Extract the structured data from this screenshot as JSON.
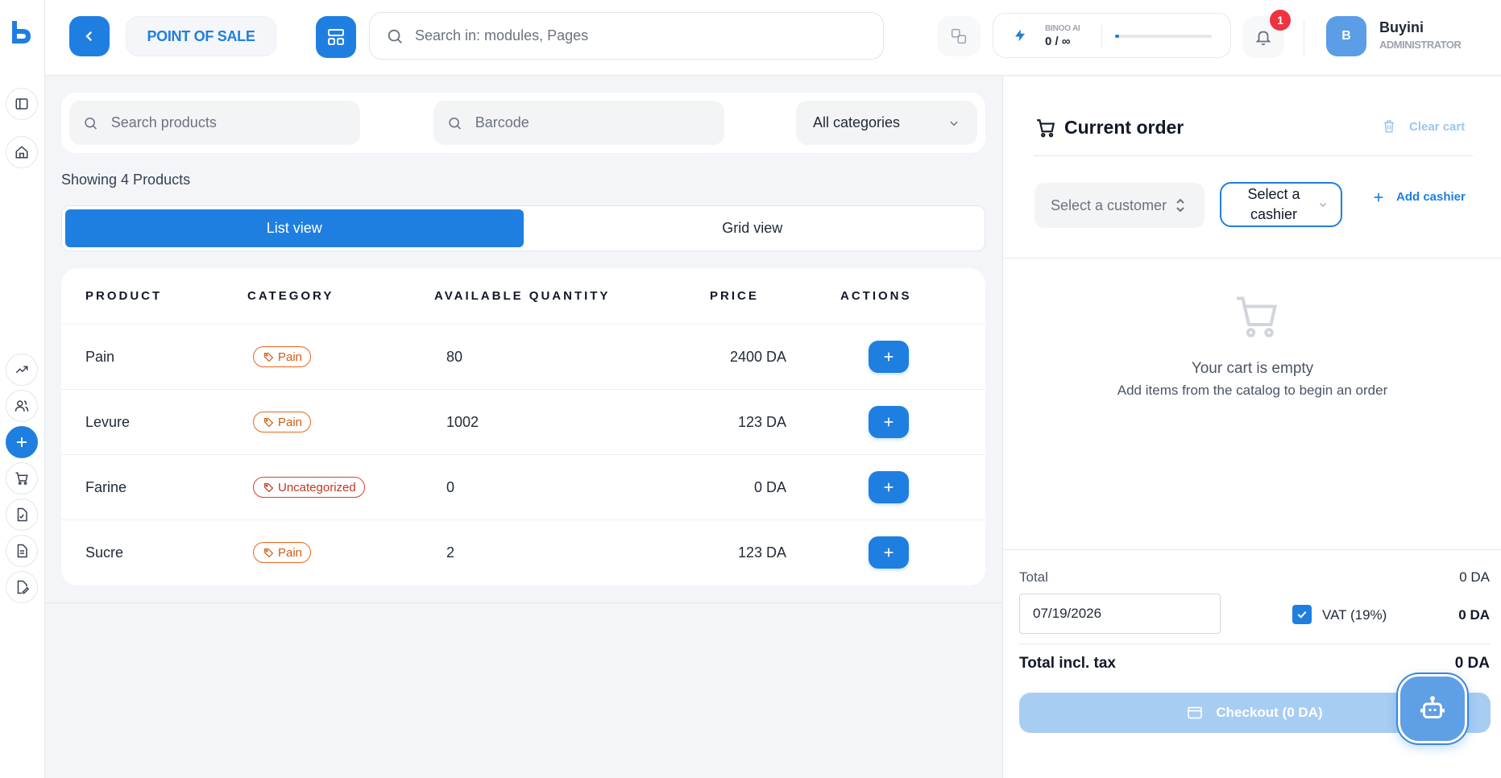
{
  "header": {
    "app_title": "POINT OF SALE",
    "search_placeholder": "Search in: modules, Pages",
    "ai": {
      "name": "BINOO AI",
      "usage": "0 / ∞",
      "progress_fraction": 0.02
    },
    "notifications_count": "1",
    "user": {
      "initial": "B",
      "name": "Buyini",
      "role": "ADMINISTRATOR"
    }
  },
  "filters": {
    "search_placeholder": "Search products",
    "barcode_placeholder": "Barcode",
    "category_selected": "All categories"
  },
  "showing_text": "Showing 4 Products",
  "view_toggle": {
    "list": "List view",
    "grid": "Grid view",
    "active": "list"
  },
  "table": {
    "headers": [
      "PRODUCT",
      "CATEGORY",
      "AVAILABLE QUANTITY",
      "PRICE",
      "ACTIONS"
    ],
    "rows": [
      {
        "product": "Pain",
        "category": "Pain",
        "quantity": "80",
        "price": "2400 DA"
      },
      {
        "product": "Levure",
        "category": "Pain",
        "quantity": "1002",
        "price": "123 DA"
      },
      {
        "product": "Farine",
        "category": "Uncategorized",
        "quantity": "0",
        "price": "0 DA"
      },
      {
        "product": "Sucre",
        "category": "Pain",
        "quantity": "2",
        "price": "123 DA"
      }
    ]
  },
  "order": {
    "title": "Current order",
    "clear_cart": "Clear cart",
    "customer_placeholder": "Select a customer",
    "cashier_placeholder": "Select a cashier",
    "add_cashier": "Add cashier",
    "empty_title": "Your cart is empty",
    "empty_subtitle": "Add items from the catalog to begin an order",
    "total_label": "Total",
    "total_value": "0 DA",
    "date_value": "07/19/2026",
    "vat_label": "VAT (19%)",
    "vat_checked": true,
    "vat_value": "0 DA",
    "total_incl_label": "Total incl. tax",
    "total_incl_value": "0 DA",
    "checkout_label": "Checkout (0 DA)"
  },
  "colors": {
    "primary": "#1f7fe0",
    "tag_orange": "#e8661f",
    "tag_red": "#d8432e",
    "badge_red": "#ef3340"
  },
  "icons": {
    "rail": [
      "sidebar-toggle-icon",
      "home-icon",
      "trend-up-icon",
      "users-icon",
      "plus-icon",
      "cart-icon",
      "file-check-icon",
      "document-icon",
      "edit-file-icon"
    ]
  }
}
